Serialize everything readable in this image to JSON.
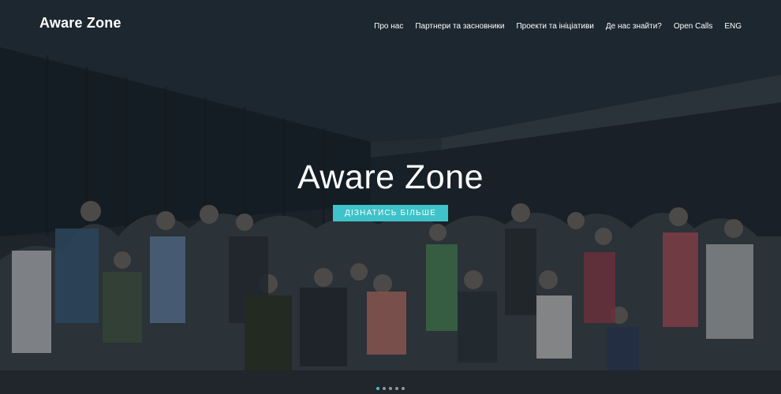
{
  "header": {
    "logo": "Aware Zone",
    "nav": [
      {
        "label": "Про нас"
      },
      {
        "label": "Партнери та засновники"
      },
      {
        "label": "Проекти та ініціативи"
      },
      {
        "label": "Де нас знайти?"
      },
      {
        "label": "Open Calls"
      },
      {
        "label": "ENG"
      }
    ]
  },
  "hero": {
    "title": "Aware Zone",
    "cta_label": "Дізнатись більше",
    "background_description_icon": "group-photo",
    "slides_total": 5,
    "active_slide": 1
  },
  "colors": {
    "accent": "#3fc2c9",
    "text": "#ffffff",
    "background": "#1c232b"
  }
}
